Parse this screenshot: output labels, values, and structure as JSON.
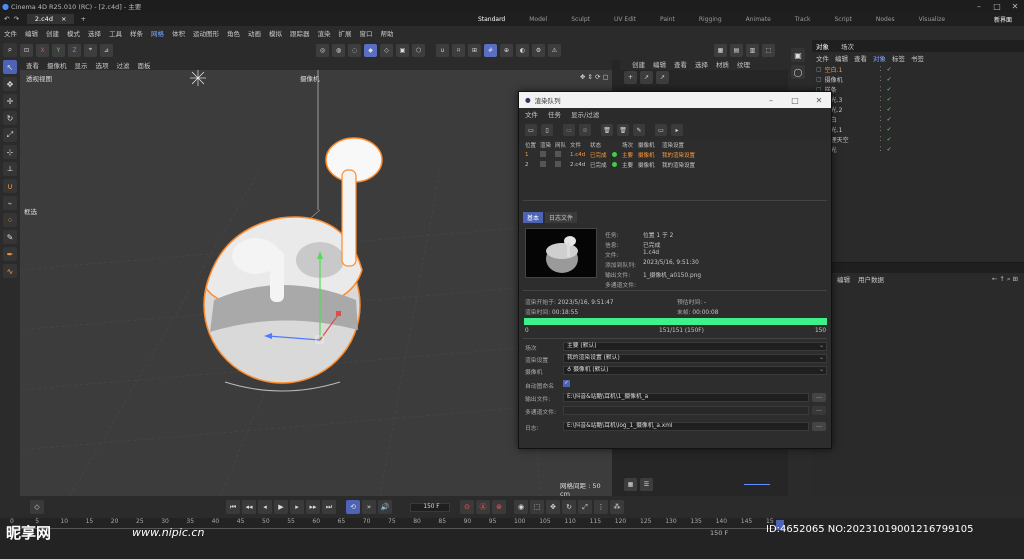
{
  "window": {
    "title": "Cinema 4D R25.010 (RC) - [2.c4d] - 主要"
  },
  "doc_tab": {
    "label": "2.c4d"
  },
  "layouts": [
    "Standard",
    "Model",
    "Sculpt",
    "UV Edit",
    "Paint",
    "Rigging",
    "Animate",
    "Track",
    "Script",
    "Nodes",
    "Visualize"
  ],
  "layout_new": "新界面",
  "menu": [
    "文件",
    "编辑",
    "创建",
    "模式",
    "选择",
    "工具",
    "样条",
    "网格",
    "体积",
    "运动图形",
    "角色",
    "动画",
    "模拟",
    "跟踪器",
    "渲染",
    "扩展",
    "窗口",
    "帮助"
  ],
  "menu_highlight": "网格",
  "viewport": {
    "menu": [
      "查看",
      "摄像机",
      "显示",
      "选项",
      "过滤",
      "面板"
    ],
    "title": "透视视图",
    "camera": "摄像机",
    "grid_info": "网格间距 : 50 cm"
  },
  "select_label": "框选",
  "mid_menu": [
    "创建",
    "编辑",
    "查看",
    "选择",
    "材质",
    "纹理"
  ],
  "right_panel": {
    "tabs": [
      "对象",
      "场次"
    ],
    "menu": [
      "文件",
      "编辑",
      "查看",
      "对象",
      "标签",
      "书签"
    ],
    "menu_highlight": "对象",
    "objects": [
      {
        "name": "空白.1",
        "selected": true
      },
      {
        "name": "摄像机",
        "selected": false
      },
      {
        "name": "样条",
        "selected": false
      },
      {
        "name": "灯光.3",
        "selected": false
      },
      {
        "name": "灯光.2",
        "selected": false
      },
      {
        "name": "空白",
        "selected": false
      },
      {
        "name": "灯光.1",
        "selected": false
      },
      {
        "name": "物理天空",
        "selected": false
      },
      {
        "name": "灯光",
        "selected": false
      }
    ],
    "attr_tabs": [
      "模式",
      "编辑",
      "用户数据"
    ],
    "attr_title": "属性"
  },
  "render_queue": {
    "title": "渲染队列",
    "menu": [
      "文件",
      "任务",
      "显示/过滤"
    ],
    "columns": [
      "位置",
      "渲染",
      "网队",
      "文件",
      "状态",
      "",
      "场次",
      "摄像机",
      "渲染设置"
    ],
    "jobs": [
      {
        "pos": "1",
        "file": "1.c4d",
        "status": "已完成",
        "take": "主要",
        "camera": "摄像机",
        "settings": "我的渲染设置",
        "active": true
      },
      {
        "pos": "2",
        "file": "2.c4d",
        "status": "已完成",
        "take": "主要",
        "camera": "摄像机",
        "settings": "我的渲染设置",
        "active": false
      }
    ],
    "subtabs": [
      "基本",
      "日志文件"
    ],
    "info": {
      "task_label": "任务:",
      "task": "位置 1 于 2",
      "state_label": "信息:",
      "state": "已完成",
      "file_label": "文件:",
      "file": "1.c4d",
      "added_label": "添加到队列:",
      "added": "2023/5/16, 9:51:30",
      "output_label": "输出文件:",
      "output": "1_摄像机_a0150.png",
      "multipass_label": "多通道文件:",
      "multipass": ""
    },
    "timing": {
      "start_label": "渲染开始于:",
      "start": "2023/5/16, 9:51:47",
      "est_label": "预估时间:",
      "est": "-",
      "elapsed_label": "渲染时间:",
      "elapsed": "00:18:55",
      "frame_label": "末帧:",
      "frame": "00:00:08"
    },
    "progress": {
      "fraction": 1.0,
      "min_label": "0",
      "max_label": "150",
      "center": "151/151 (150F)"
    },
    "settings": {
      "take_label": "场次",
      "take": "主要 (默认)",
      "rs_label": "渲染设置",
      "rs": "我的渲染设置 (默认)",
      "cam_label": "摄像机",
      "cam": "摄像机 (默认)",
      "autoname_label": "自动图命名",
      "out_label": "输出文件:",
      "out": "E:\\抖音&站酷\\耳机\\1_摄像机_a",
      "mp_label": "多通道文件:",
      "mp": "",
      "log_label": "日志:",
      "log": "E:\\抖音&站酷\\耳机\\log_1_摄像机_a.xml"
    }
  },
  "transport": {
    "frame_field": "150 F"
  },
  "timeline": {
    "ticks": [
      "0",
      "5",
      "10",
      "15",
      "20",
      "25",
      "30",
      "35",
      "40",
      "45",
      "50",
      "55",
      "60",
      "65",
      "70",
      "75",
      "80",
      "85",
      "90",
      "95",
      "100",
      "105",
      "110",
      "115",
      "120",
      "125",
      "130",
      "135",
      "140",
      "145",
      "15"
    ],
    "start": "0 F",
    "end_label": "150 F"
  },
  "watermark": {
    "logo": "昵享网",
    "url": "www.nipic.cn",
    "id": "ID:4652065 NO:20231019001216799105"
  },
  "colors": {
    "accent": "#4c63b6",
    "progress": "#3ef28b",
    "selected_obj": "#ff9a3a"
  }
}
